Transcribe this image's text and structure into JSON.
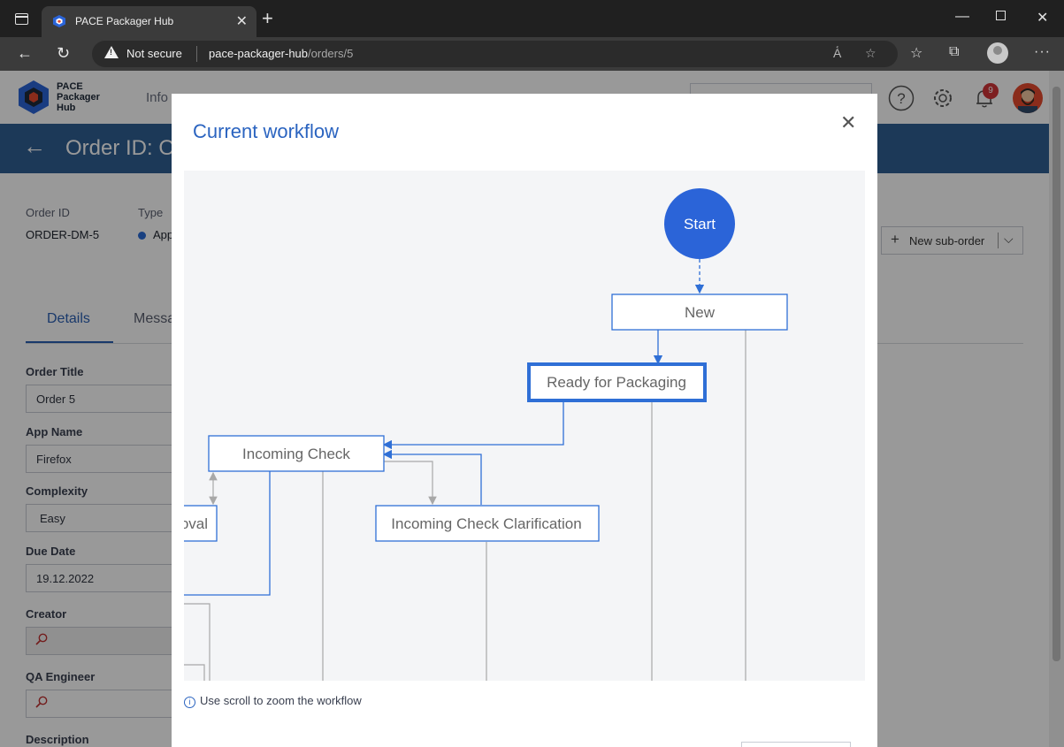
{
  "browser": {
    "tab_title": "PACE Packager Hub",
    "security_label": "Not secure",
    "url_host": "pace-packager-hub",
    "url_path": "/orders/5"
  },
  "app": {
    "logo_lines": [
      "PACE",
      "Packager",
      "Hub"
    ],
    "nav_faded": "Info",
    "notification_count": "9"
  },
  "banner": {
    "title": "Order ID: O"
  },
  "order_meta": {
    "order_id_label": "Order ID",
    "order_id_value": "ORDER-DM-5",
    "type_label": "Type",
    "type_value": "App"
  },
  "actions": {
    "new_suborder": "New sub-order"
  },
  "tabs": {
    "details": "Details",
    "messages": "Messa"
  },
  "form": {
    "order_title_label": "Order Title",
    "order_title_value": "Order 5",
    "app_name_label": "App Name",
    "app_name_value": "Firefox",
    "complexity_label": "Complexity",
    "complexity_value": "Easy",
    "due_date_label": "Due Date",
    "due_date_value": "19.12.2022",
    "creator_label": "Creator",
    "qa_label": "QA Engineer",
    "description_label": "Description"
  },
  "modal": {
    "title": "Current workflow",
    "hint": "Use scroll to zoom the workflow"
  },
  "workflow": {
    "start": "Start",
    "new": "New",
    "ready": "Ready for Packaging",
    "incoming": "Incoming Check",
    "clarification": "Incoming Check Clarification",
    "approval_partial": "oval"
  },
  "colors": {
    "accent": "#2b64c0",
    "node_border": "#2f6fd6",
    "banner": "#2f5f93",
    "start_fill": "#2b64d8"
  }
}
